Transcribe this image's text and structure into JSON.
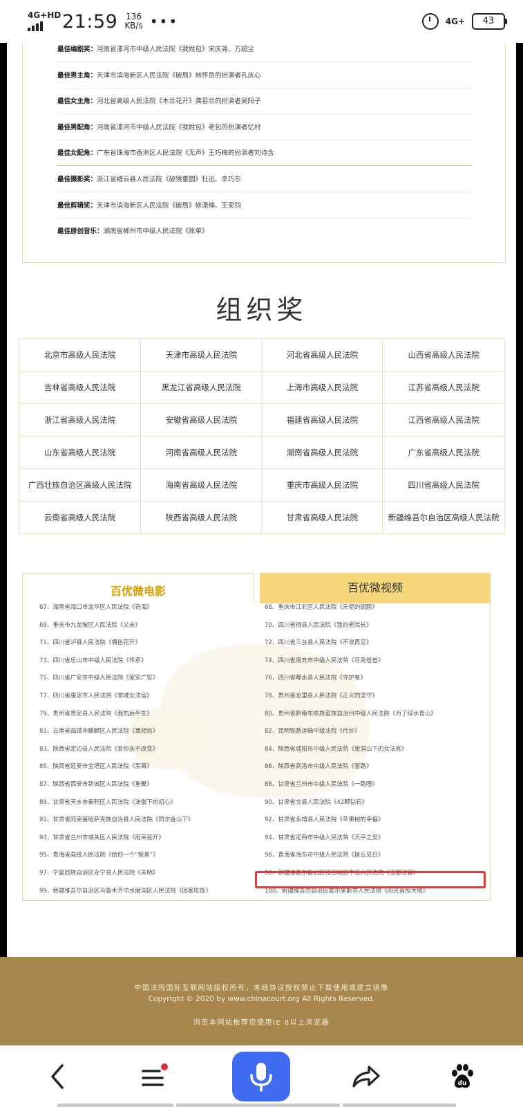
{
  "status_bar": {
    "network": "4G+HD",
    "time": "21:59",
    "speed_value": "136",
    "speed_unit": "KB/s",
    "dots": "•••",
    "network_right": "4G+",
    "battery": "43"
  },
  "awards": [
    {
      "category": "最佳编剧奖：",
      "text": "河南省漯河市中级人民法院《我姓包》宋庆尧、万超尘"
    },
    {
      "category": "最佳男主角：",
      "text": "天津市滨海新区人民法院《破局》林怀岳的扮演者孔庆心"
    },
    {
      "category": "最佳女主角：",
      "text": "河北省高级人民法院《木兰花开》龚若兰的扮演者吴阳子"
    },
    {
      "category": "最佳男配角：",
      "text": "河南省漯河市中级人民法院《我姓包》老包的扮演者忆村"
    },
    {
      "category": "最佳女配角：",
      "text": "广东省珠海市香洲区人民法院《无声》王巧梅的扮演者刘诗含"
    },
    {
      "category": "最佳摄影奖：",
      "text": "浙江省缙云县人民法院《破镜重圆》杜迅、李巧东"
    },
    {
      "category": "最佳剪辑奖：",
      "text": "天津市滨海新区人民法院《破局》修潇楠、王奕钧"
    },
    {
      "category": "最佳原创音乐：",
      "text": "湖南省郴州市中级人民法院《账单》"
    }
  ],
  "org_award_title": "组织奖",
  "org_courts": [
    [
      "北京市高级人民法院",
      "天津市高级人民法院",
      "河北省高级人民法院",
      "山西省高级人民法院"
    ],
    [
      "吉林省高级人民法院",
      "黑龙江省高级人民法院",
      "上海市高级人民法院",
      "江苏省高级人民法院"
    ],
    [
      "浙江省高级人民法院",
      "安徽省高级人民法院",
      "福建省高级人民法院",
      "江西省高级人民法院"
    ],
    [
      "山东省高级人民法院",
      "河南省高级人民法院",
      "湖南省高级人民法院",
      "广东省高级人民法院"
    ],
    [
      "广西壮族自治区高级人民法院",
      "海南省高级人民法院",
      "重庆市高级人民法院",
      "四川省高级人民法院"
    ],
    [
      "云南省高级人民法院",
      "陕西省高级人民法院",
      "甘肃省高级人民法院",
      "新疆维吾尔自治区高级人民法院"
    ]
  ],
  "tabs": {
    "film": "百优微电影",
    "video": "百优微视频"
  },
  "film_left": [
    "67、海南省海口市龙华区人民法院《符海》",
    "69、重庆市九龙坡区人民法院《父亲》",
    "71、四川省泸县人民法院《偶色花开》",
    "73、四川省乐山市中级人民法院《传承》",
    "75、四川省广安市中级人民法院《家安广安》",
    "77、四川省康定市人民法院《雪域女法官》",
    "79、贵州省贵定县人民法院《我的后半生》",
    "81、云南省曲靖市麒麟区人民法院《我相信》",
    "83、陕西省定边县人民法院《爱你永不改变》",
    "85、陕西省延安市宝塔区人民法院《黑幕》",
    "87、陕西省西安市新城区人民法院《重聚》",
    "89、甘肃省天水市秦积区人民法院《法徽下的初心》",
    "91、甘肃省阿克塞哈萨克族自治县人民法院《同尔金山下》",
    "93、甘肃省兰州市城关区人民法院《雨荣芸开》",
    "95、青海省高级人民法院《给你一个“惊喜”》",
    "97、宁夏回族自治区永宁县人民法院《未明》",
    "99、新疆维吾尔自治区乌鲁木齐市水磨沟区人民法院《回家吃饭》"
  ],
  "film_right": [
    "68、重庆市江北区人民法院《天使的翅膀》",
    "70、四川省得县人民法院《我的老院长》",
    "72、四川省三台县人民法院《不说再见》",
    "74、四川省南充市中级人民法院《月亮爸爸》",
    "76、四川省郫水县人民法院《守护者》",
    "78、贵州省龙里县人民法院《正义的坚守》",
    "80、贵州省黔南布依族苗族自治州中级人民法院《为了绿水青山》",
    "82、昆明铁路运输中级法院《代价》",
    "84、陕西省咸阳市中级人民法院《崖洞山下的女法官》",
    "86、陕西省商洛市中级人民法院《套路》",
    "88、甘肃省兰州市中级人民法院《一路哩》",
    "90、甘肃省文县人民法院《42颗钻石》",
    "92、甘肃省永靖县人民法院《苹果树的幸福》",
    "94、甘肃省定西市中级人民法院《天平之爱》",
    "96、青海省海东市中级人民法院《拨云见日》",
    "98、新疆维吾尔自治区和田地区中级人民法院《玉都法官》",
    "100、新疆维吾尔自治区霍尔果斯市人民法院《阳光普照大地》"
  ],
  "footer": {
    "line1": "中国法院国际互联网站版权所有，未经协议授权禁止下载使用或建立镜像",
    "line2": "Copyright © 2020 by www.chinacourt.org All Rights Reserved.",
    "line3": "浏览本网站推荐您使用IE 8以上浏览器"
  },
  "colors": {
    "accent_gold": "#d9a100",
    "tab_active_bg": "#f7d77c",
    "footer_bg": "#a8874e",
    "highlight_red": "#e53935",
    "mic_blue": "#3f6cf0"
  },
  "icons": {
    "back": "chevron-left-icon",
    "menu": "menu-icon",
    "mic": "microphone-icon",
    "share": "share-icon",
    "baidu": "baidu-paw-icon"
  }
}
